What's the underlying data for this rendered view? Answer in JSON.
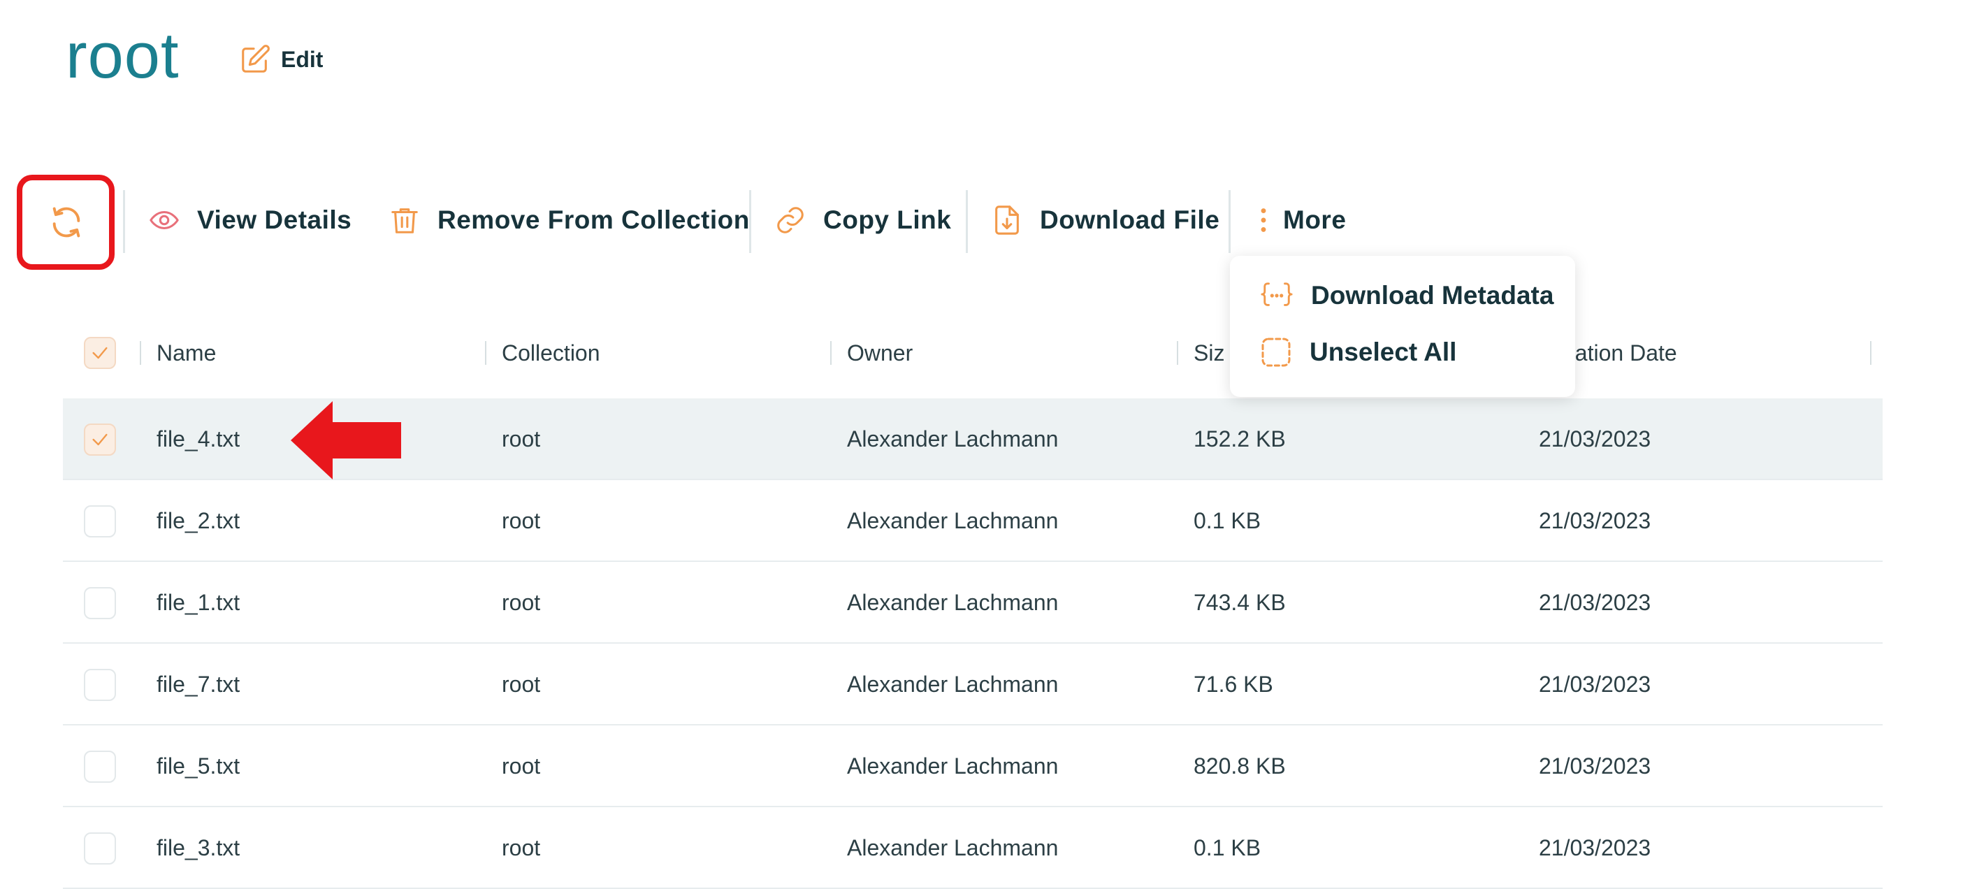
{
  "page": {
    "title": "root",
    "edit_label": "Edit"
  },
  "toolbar": {
    "view_details": "View Details",
    "remove_from_collection": "Remove From Collection",
    "copy_link": "Copy Link",
    "download_file": "Download File",
    "more": "More"
  },
  "more_menu": {
    "items": [
      "Download Metadata",
      "Unselect All"
    ]
  },
  "table": {
    "columns": [
      "Name",
      "Collection",
      "Owner",
      "Siz",
      "eation Date"
    ],
    "rows": [
      {
        "selected": true,
        "name": "file_4.txt",
        "collection": "root",
        "owner": "Alexander Lachmann",
        "size": "152.2 KB",
        "date": "21/03/2023"
      },
      {
        "selected": false,
        "name": "file_2.txt",
        "collection": "root",
        "owner": "Alexander Lachmann",
        "size": "0.1 KB",
        "date": "21/03/2023"
      },
      {
        "selected": false,
        "name": "file_1.txt",
        "collection": "root",
        "owner": "Alexander Lachmann",
        "size": "743.4 KB",
        "date": "21/03/2023"
      },
      {
        "selected": false,
        "name": "file_7.txt",
        "collection": "root",
        "owner": "Alexander Lachmann",
        "size": "71.6 KB",
        "date": "21/03/2023"
      },
      {
        "selected": false,
        "name": "file_5.txt",
        "collection": "root",
        "owner": "Alexander Lachmann",
        "size": "820.8 KB",
        "date": "21/03/2023"
      },
      {
        "selected": false,
        "name": "file_3.txt",
        "collection": "root",
        "owner": "Alexander Lachmann",
        "size": "0.1 KB",
        "date": "21/03/2023"
      }
    ]
  },
  "colors": {
    "title": "#1b7f8f",
    "accent_orange": "#f2994a",
    "annotation_red": "#e8171c",
    "text_dark": "#17333b",
    "selected_row": "#edf2f3"
  },
  "icons": [
    "edit-icon",
    "refresh-icon",
    "eye-icon",
    "trash-icon",
    "link-icon",
    "download-file-icon",
    "more-vertical-icon",
    "braces-icon",
    "dashed-square-icon",
    "check-icon"
  ]
}
